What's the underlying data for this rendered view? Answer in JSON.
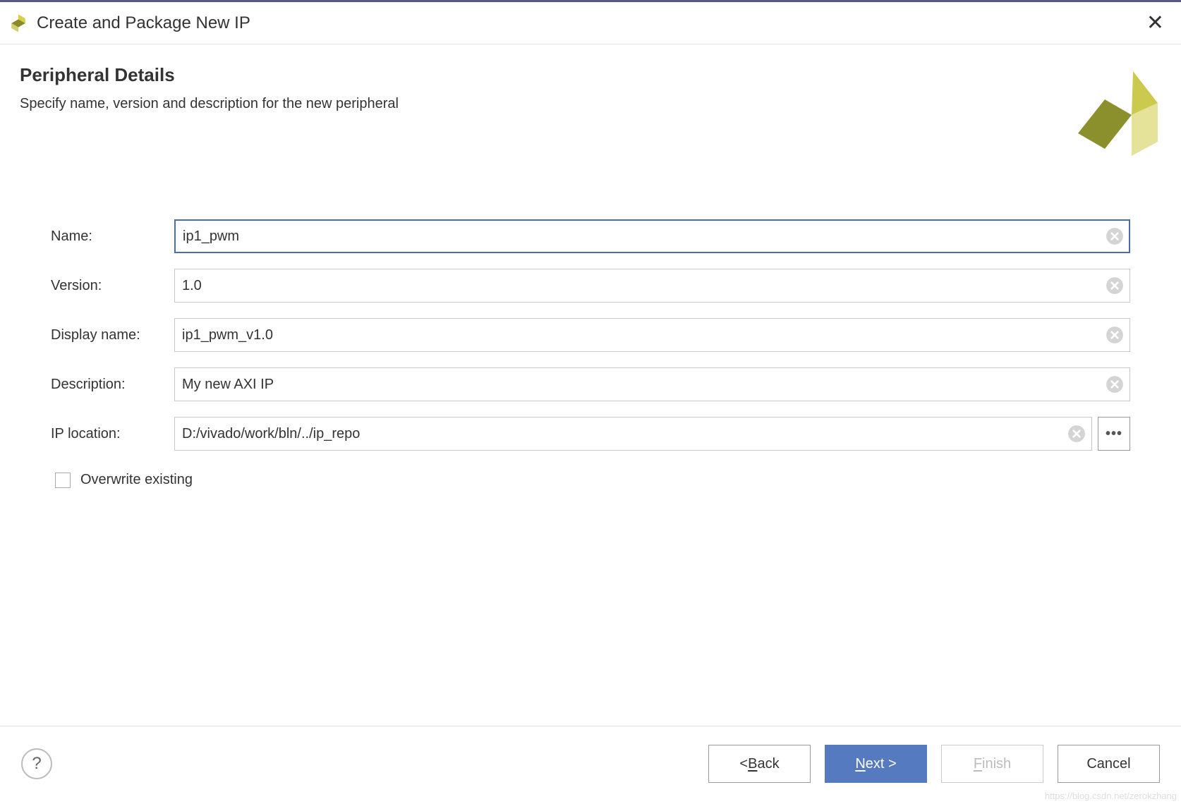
{
  "window": {
    "title": "Create and Package New IP"
  },
  "header": {
    "title": "Peripheral Details",
    "subtitle": "Specify name, version and description for the new peripheral"
  },
  "form": {
    "name_label": "Name:",
    "name_value": "ip1_pwm",
    "version_label": "Version:",
    "version_value": "1.0",
    "display_name_label": "Display name:",
    "display_name_value": "ip1_pwm_v1.0",
    "description_label": "Description:",
    "description_value": "My new AXI IP",
    "ip_location_label": "IP location:",
    "ip_location_value": "D:/vivado/work/bln/../ip_repo",
    "overwrite_label": "Overwrite existing",
    "overwrite_checked": false
  },
  "footer": {
    "back_prefix": "< ",
    "back_letter": "B",
    "back_rest": "ack",
    "next_letter": "N",
    "next_rest": "ext >",
    "finish_letter": "F",
    "finish_rest": "inish",
    "cancel": "Cancel"
  },
  "watermark": "https://blog.csdn.net/zerokzhang"
}
